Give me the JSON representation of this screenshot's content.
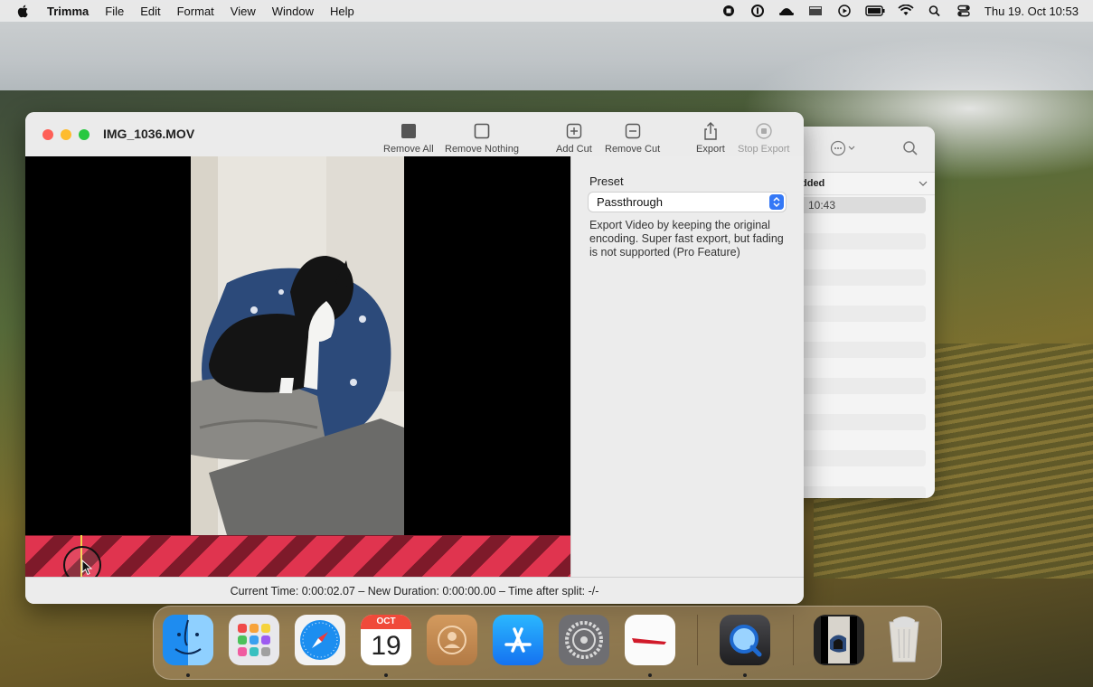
{
  "menubar": {
    "app": "Trimma",
    "menus": [
      "File",
      "Edit",
      "Format",
      "View",
      "Window",
      "Help"
    ],
    "clock": "Thu 19. Oct  10:53"
  },
  "window": {
    "title": "IMG_1036.MOV",
    "toolbar": {
      "remove_all": "Remove All",
      "remove_nothing": "Remove Nothing",
      "add_cut": "Add Cut",
      "remove_cut": "Remove Cut",
      "export": "Export",
      "stop_export": "Stop Export"
    },
    "sidebar": {
      "preset_label": "Preset",
      "preset_value": "Passthrough",
      "description": "Export Video by keeping the original encoding. Super fast export, but fading is not supported (Pro Feature)"
    },
    "status": "Current Time: 0:00:02.07 – New Duration: 0:00:00.00 – Time after split: -/-"
  },
  "back_window": {
    "header": "dded",
    "time": "10:43"
  },
  "dock": {
    "calendar_month": "OCT",
    "calendar_day": "19"
  }
}
